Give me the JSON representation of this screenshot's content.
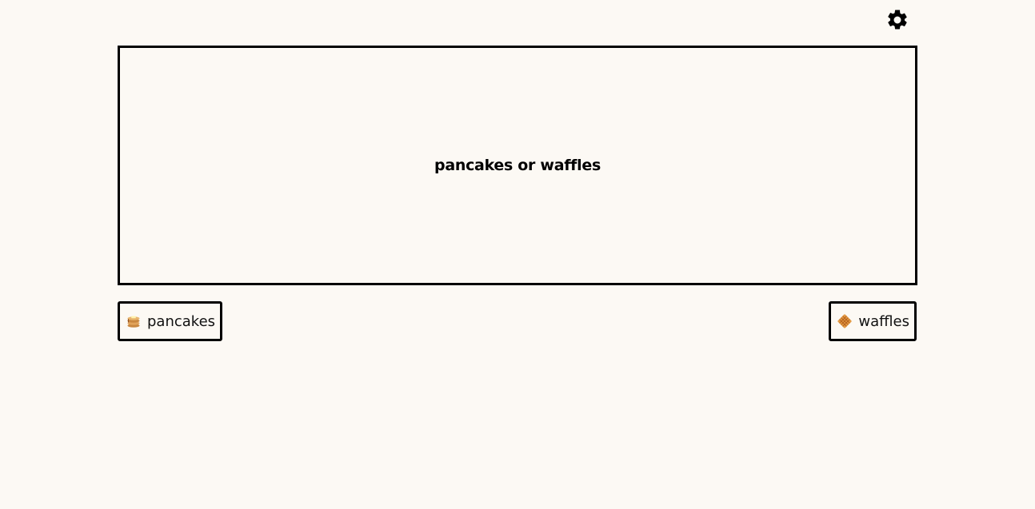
{
  "header": {
    "settings_icon": "gear-icon"
  },
  "question": {
    "text": "pancakes or waffles"
  },
  "choices": [
    {
      "label": "pancakes",
      "icon": "pancakes-emoji-icon"
    },
    {
      "label": "waffles",
      "icon": "waffle-emoji-icon"
    }
  ],
  "colors": {
    "background": "#fcf9f4",
    "border": "#000000",
    "text": "#111111"
  }
}
